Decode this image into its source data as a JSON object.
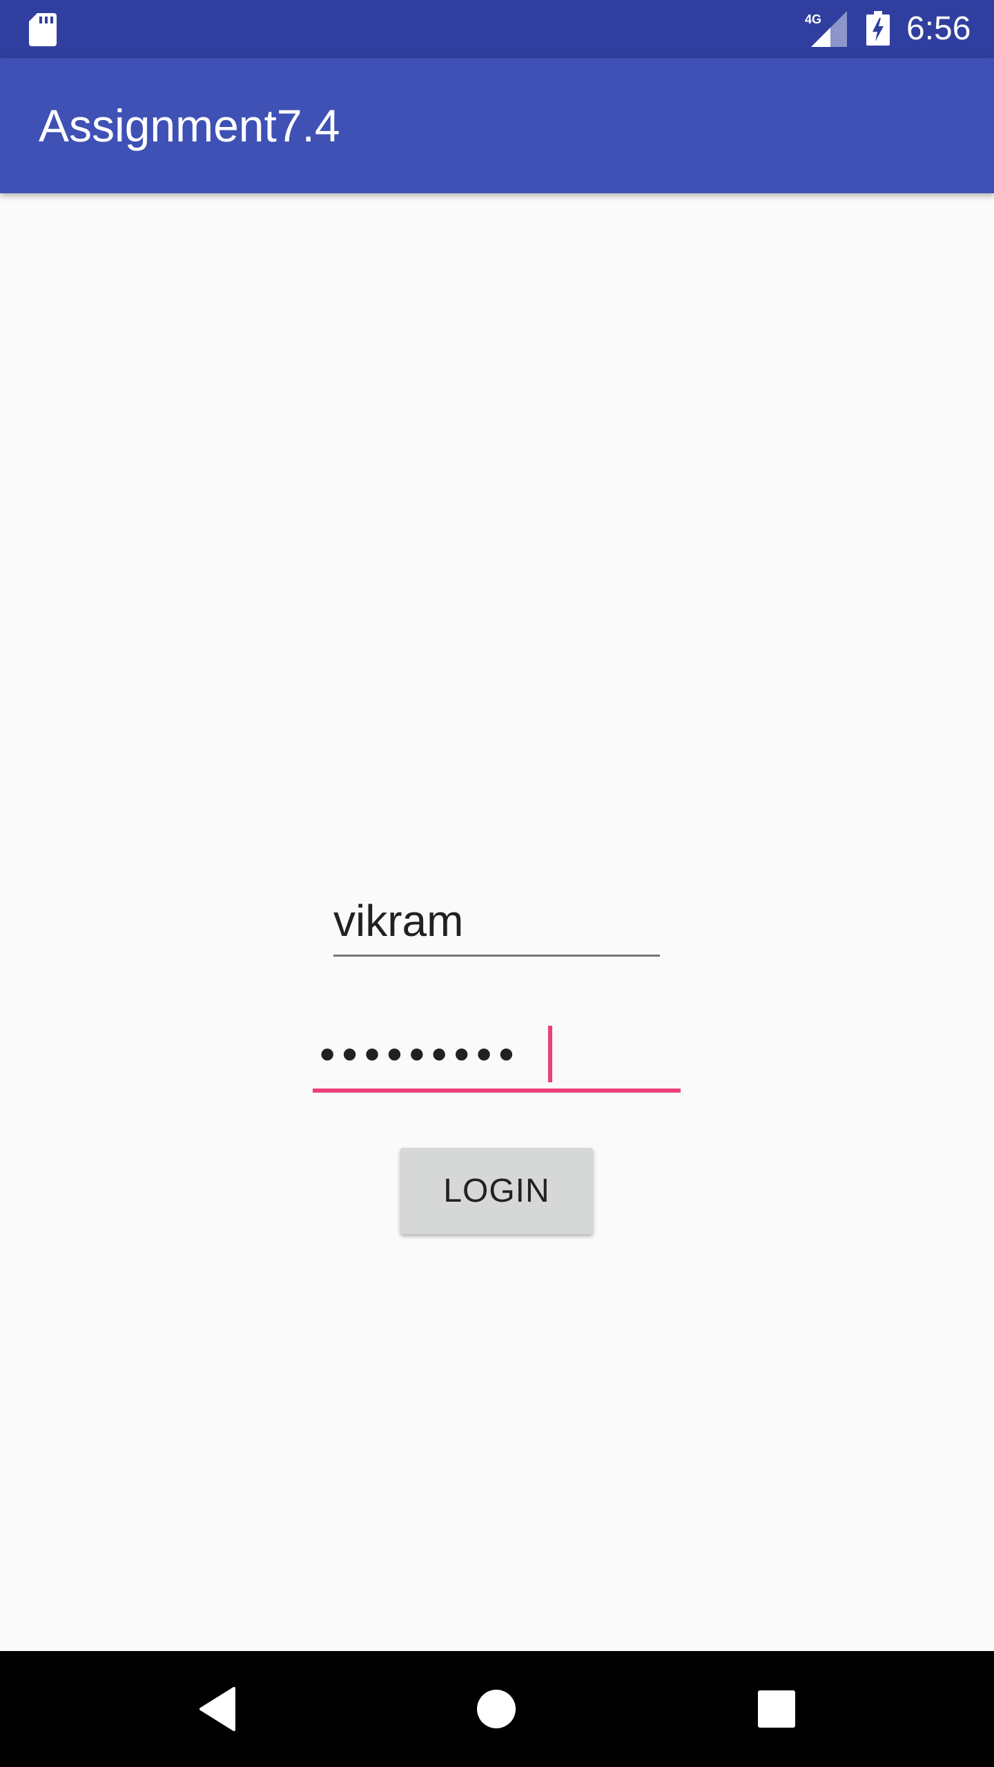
{
  "status_bar": {
    "time": "6:56",
    "network_label": "4G",
    "icons": [
      "sd-card-icon",
      "signal-4g-icon",
      "battery-charging-icon"
    ]
  },
  "app_bar": {
    "title": "Assignment7.4"
  },
  "form": {
    "username_value": "vikram",
    "password_mask": "•••••••••",
    "login_label": "LOGIN"
  },
  "nav_bar": {
    "icons": [
      "back-icon",
      "home-icon",
      "recents-icon"
    ]
  },
  "colors": {
    "status_bar": "#303f9f",
    "app_bar": "#3f51b5",
    "accent": "#ec407a",
    "background": "#fafafa",
    "button": "#d6d7d7",
    "nav_bar": "#000000"
  }
}
